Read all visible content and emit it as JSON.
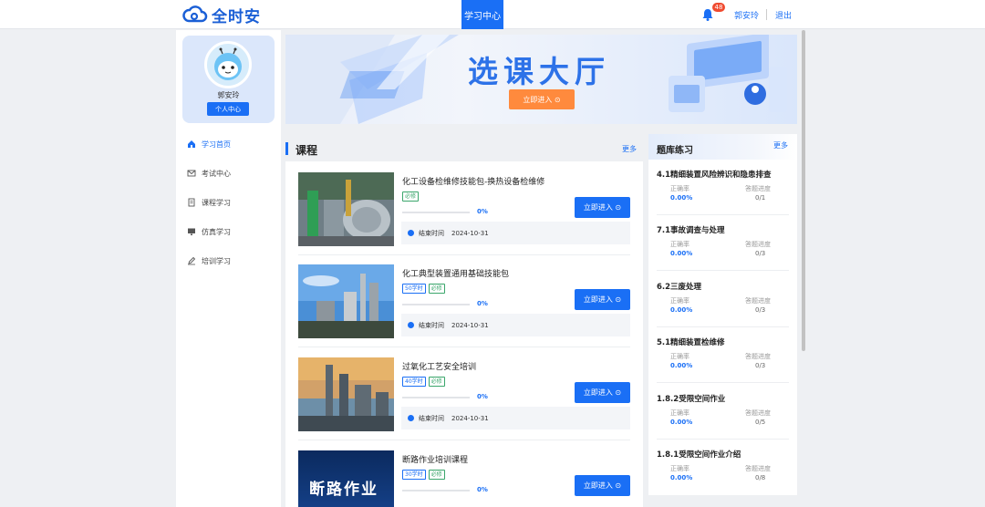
{
  "header": {
    "logo_text": "全时安",
    "active_tab": "学习中心",
    "notification_count": "48",
    "user_name": "郭安玲",
    "logout_label": "退出"
  },
  "profile": {
    "name": "郭安玲",
    "center_button": "个人中心"
  },
  "menu": [
    {
      "label": "学习首页",
      "icon": "home-icon",
      "active": true
    },
    {
      "label": "考试中心",
      "icon": "exam-icon",
      "active": false
    },
    {
      "label": "课程学习",
      "icon": "course-icon",
      "active": false
    },
    {
      "label": "仿真学习",
      "icon": "monitor-icon",
      "active": false
    },
    {
      "label": "培训学习",
      "icon": "pencil-icon",
      "active": false
    }
  ],
  "banner": {
    "title": "选课大厅",
    "enter_button": "立即进入 ⊙"
  },
  "courses_section": {
    "title": "课程",
    "more": "更多",
    "items": [
      {
        "name": "化工设备检维修技能包-换热设备检维修",
        "tags": [
          "必修"
        ],
        "progress": "0%",
        "end_label": "结束时间",
        "end_date": "2024-10-31",
        "enter": "立即进入 ⊙"
      },
      {
        "name": "化工典型装置通用基础技能包",
        "tags": [
          "50学时",
          "必修"
        ],
        "progress": "0%",
        "end_label": "结束时间",
        "end_date": "2024-10-31",
        "enter": "立即进入 ⊙"
      },
      {
        "name": "过氧化工艺安全培训",
        "tags": [
          "40学时",
          "必修"
        ],
        "progress": "0%",
        "end_label": "结束时间",
        "end_date": "2024-10-31",
        "enter": "立即进入 ⊙"
      },
      {
        "name": "断路作业培训课程",
        "tags": [
          "30学时",
          "必修"
        ],
        "progress": "0%",
        "end_label": "",
        "end_date": "",
        "enter": "立即进入 ⊙",
        "thumb_text": "断路作业"
      }
    ]
  },
  "question_bank": {
    "title": "题库练习",
    "more": "更多",
    "items": [
      {
        "name": "4.1精细装置风险辨识和隐患排查",
        "rate_label": "正确率",
        "rate": "0.00%",
        "progress_label": "答题进度",
        "progress": "0/1"
      },
      {
        "name": "7.1事故调查与处理",
        "rate_label": "正确率",
        "rate": "0.00%",
        "progress_label": "答题进度",
        "progress": "0/3"
      },
      {
        "name": "6.2三废处理",
        "rate_label": "正确率",
        "rate": "0.00%",
        "progress_label": "答题进度",
        "progress": "0/3"
      },
      {
        "name": "5.1精细装置检维修",
        "rate_label": "正确率",
        "rate": "0.00%",
        "progress_label": "答题进度",
        "progress": "0/3"
      },
      {
        "name": "1.8.2受限空间作业",
        "rate_label": "正确率",
        "rate": "0.00%",
        "progress_label": "答题进度",
        "progress": "0/5"
      },
      {
        "name": "1.8.1受限空间作业介绍",
        "rate_label": "正确率",
        "rate": "0.00%",
        "progress_label": "答题进度",
        "progress": "0/8"
      }
    ]
  },
  "colors": {
    "primary": "#1a6ff5",
    "accent_orange": "#ff8a3d",
    "badge_red": "#f04a2f",
    "tag_green": "#3aa66b"
  }
}
